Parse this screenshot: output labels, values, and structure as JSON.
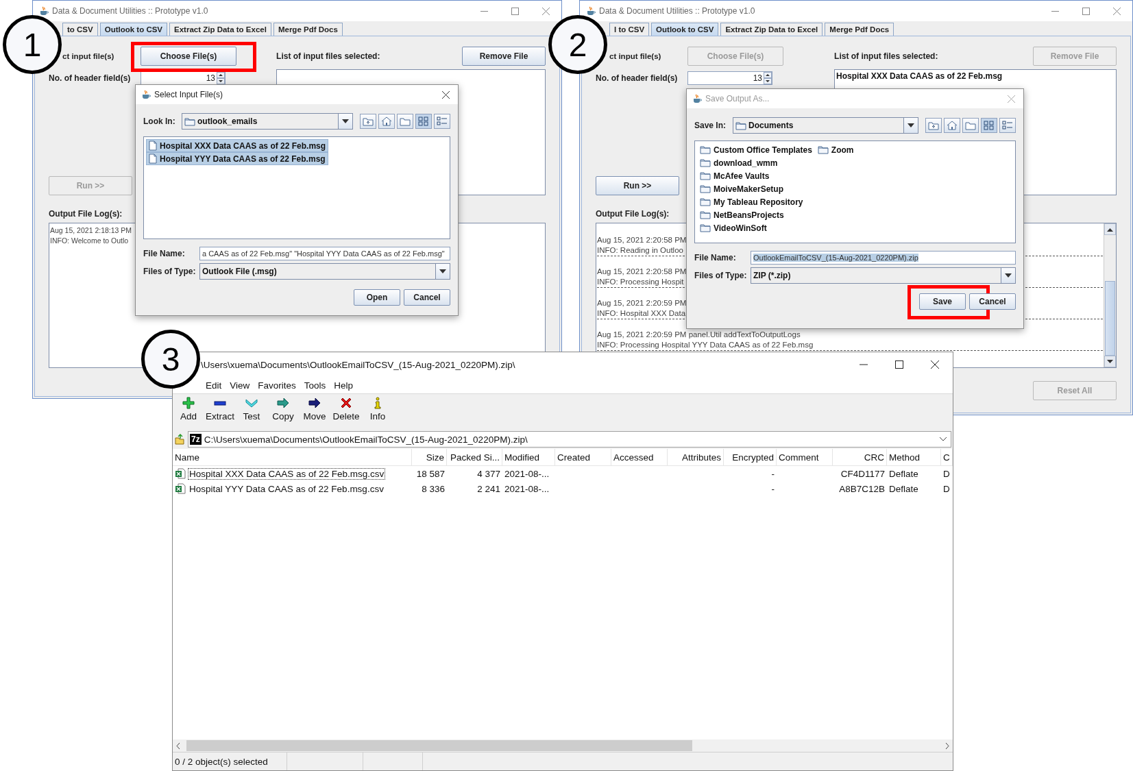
{
  "callouts": [
    {
      "label": "1"
    },
    {
      "label": "2"
    },
    {
      "label": "3"
    }
  ],
  "app_windows": [
    {
      "title": "Data & Document Utilities :: Prototype v1.0",
      "tabs": [
        {
          "label": "to CSV",
          "selected": false
        },
        {
          "label": "Outlook to CSV",
          "selected": true
        },
        {
          "label": "Extract Zip Data to Excel",
          "selected": false
        },
        {
          "label": "Merge Pdf Docs",
          "selected": false
        }
      ],
      "input_label": "ct input file(s)",
      "choose_button": {
        "label": "Choose File(s)",
        "disabled": false,
        "highlighted": true
      },
      "list_label": "List of input files selected:",
      "remove_button": {
        "label": "Remove File",
        "disabled": false
      },
      "header_label": "No. of header field(s)",
      "header_value": "13",
      "run_button": {
        "label": "Run >>",
        "disabled": true
      },
      "log_label": "Output File Log(s):",
      "log_entries": [
        {
          "lines": [
            "Aug 15, 2021 2:18:13 PM",
            "INFO: Welcome to Outlo"
          ]
        }
      ]
    },
    {
      "title": "Data & Document Utilities :: Prototype v1.0",
      "tabs": [
        {
          "label": "l to CSV",
          "selected": false
        },
        {
          "label": "Outlook to CSV",
          "selected": true
        },
        {
          "label": "Extract Zip Data to Excel",
          "selected": false
        },
        {
          "label": "Merge Pdf Docs",
          "selected": false
        }
      ],
      "input_label": "ct input file(s)",
      "choose_button": {
        "label": "Choose File(s)",
        "disabled": true
      },
      "list_label": "List of input files selected:",
      "remove_button": {
        "label": "Remove File",
        "disabled": true
      },
      "header_label": "No. of header field(s)",
      "header_value": "13",
      "selected_files": [
        "Hospital XXX Data CAAS as of 22 Feb.msg"
      ],
      "run_button": {
        "label": "Run >>",
        "disabled": false
      },
      "log_label": "Output File Log(s):",
      "log_entries": [
        {
          "lines": [
            "Aug 15, 2021 2:20:58 PM",
            "INFO: Reading in Outloo"
          ],
          "separator": true
        },
        {
          "lines": [
            "Aug 15, 2021 2:20:58 PM",
            "INFO: Processing Hospit"
          ],
          "separator": true
        },
        {
          "lines": [
            "Aug 15, 2021 2:20:59 PM",
            "INFO: Hospital XXX Data"
          ],
          "separator": true
        },
        {
          "lines": [
            "Aug 15, 2021 2:20:59 PM panel.Util addTextToOutputLogs",
            "INFO: Processing Hospital YYY Data CAAS as of 22 Feb.msg"
          ],
          "separator": true
        }
      ],
      "reset_button": {
        "label": "Reset All",
        "disabled": true
      }
    }
  ],
  "dialogs": [
    {
      "title": "Select Input File(s)",
      "active": true,
      "location_label": "Look In:",
      "location_value": "outlook_emails",
      "view_buttons": [
        {
          "selected": false
        },
        {
          "selected": false
        },
        {
          "selected": false
        },
        {
          "selected": true
        },
        {
          "selected": false
        }
      ],
      "items": [
        {
          "name": "Hospital XXX Data CAAS as of 22 Feb.msg",
          "kind": "file",
          "selected": true
        },
        {
          "name": "Hospital YYY Data CAAS as of 22 Feb.msg",
          "kind": "file",
          "selected": true
        }
      ],
      "file_name_label": "File Name:",
      "file_name_value": "a CAAS as of 22 Feb.msg\" \"Hospital YYY Data CAAS as of 22 Feb.msg\"",
      "file_name_selected": false,
      "type_label": "Files of Type:",
      "type_value": "Outlook File (.msg)",
      "buttons": [
        {
          "label": "Open"
        },
        {
          "label": "Cancel"
        }
      ]
    },
    {
      "title": "Save Output As...",
      "active": false,
      "location_label": "Save In:",
      "location_value": "Documents",
      "view_buttons": [
        {
          "selected": false
        },
        {
          "selected": false
        },
        {
          "selected": false
        },
        {
          "selected": true
        },
        {
          "selected": false
        }
      ],
      "items": [
        {
          "name": "Custom Office Templates",
          "kind": "folder",
          "selected": false
        },
        {
          "name": "download_wmm",
          "kind": "folder",
          "selected": false
        },
        {
          "name": "McAfee Vaults",
          "kind": "folder",
          "selected": false
        },
        {
          "name": "MoiveMakerSetup",
          "kind": "folder",
          "selected": false
        },
        {
          "name": "My Tableau Repository",
          "kind": "folder",
          "selected": false
        },
        {
          "name": "NetBeansProjects",
          "kind": "folder",
          "selected": false
        },
        {
          "name": "VideoWinSoft",
          "kind": "folder",
          "selected": false
        },
        {
          "name": "Zoom",
          "kind": "folder",
          "selected": false
        }
      ],
      "file_name_label": "File Name:",
      "file_name_value": "OutlookEmailToCSV_(15-Aug-2021_0220PM).zip",
      "file_name_selected": true,
      "type_label": "Files of Type:",
      "type_value": "ZIP (*.zip)",
      "buttons": [
        {
          "label": "Save",
          "highlighted": true
        },
        {
          "label": "Cancel"
        }
      ]
    }
  ],
  "archive_window": {
    "title": "\\Users\\xuema\\Documents\\OutlookEmailToCSV_(15-Aug-2021_0220PM).zip\\",
    "menu": [
      "Edit",
      "View",
      "Favorites",
      "Tools",
      "Help"
    ],
    "toolbar": [
      {
        "label": "Add",
        "kind": "add"
      },
      {
        "label": "Extract",
        "kind": "extract"
      },
      {
        "label": "Test",
        "kind": "test"
      },
      {
        "label": "Copy",
        "kind": "copy"
      },
      {
        "label": "Move",
        "kind": "move"
      },
      {
        "label": "Delete",
        "kind": "delete"
      },
      {
        "label": "Info",
        "kind": "info"
      }
    ],
    "badge": "7z",
    "path": "C:\\Users\\xuema\\Documents\\OutlookEmailToCSV_(15-Aug-2021_0220PM).zip\\",
    "columns": [
      {
        "label": "Name",
        "numeric": false
      },
      {
        "label": "Size",
        "numeric": true
      },
      {
        "label": "Packed Si...",
        "numeric": true
      },
      {
        "label": "Modified",
        "numeric": false
      },
      {
        "label": "Created",
        "numeric": false
      },
      {
        "label": "Accessed",
        "numeric": false
      },
      {
        "label": "Attributes",
        "numeric": true
      },
      {
        "label": "Encrypted",
        "numeric": true
      },
      {
        "label": "Comment",
        "numeric": false
      },
      {
        "label": "CRC",
        "numeric": true
      },
      {
        "label": "Method",
        "numeric": false
      },
      {
        "label": "C",
        "numeric": false
      }
    ],
    "rows": [
      {
        "focused": true,
        "name": "Hospital XXX Data CAAS as of 22 Feb.msg.csv",
        "size": "18 587",
        "packed": "4 377",
        "modified": "2021-08-...",
        "encrypted": "-",
        "crc": "CF4D1177",
        "method": "Deflate",
        "column_12": "D"
      },
      {
        "focused": false,
        "name": "Hospital YYY Data CAAS as of 22 Feb.msg.csv",
        "size": "8 336",
        "packed": "2 241",
        "modified": "2021-08-...",
        "encrypted": "-",
        "crc": "A8B7C12B",
        "method": "Deflate",
        "column_12": "D"
      }
    ],
    "status": "0 / 2 object(s) selected"
  }
}
